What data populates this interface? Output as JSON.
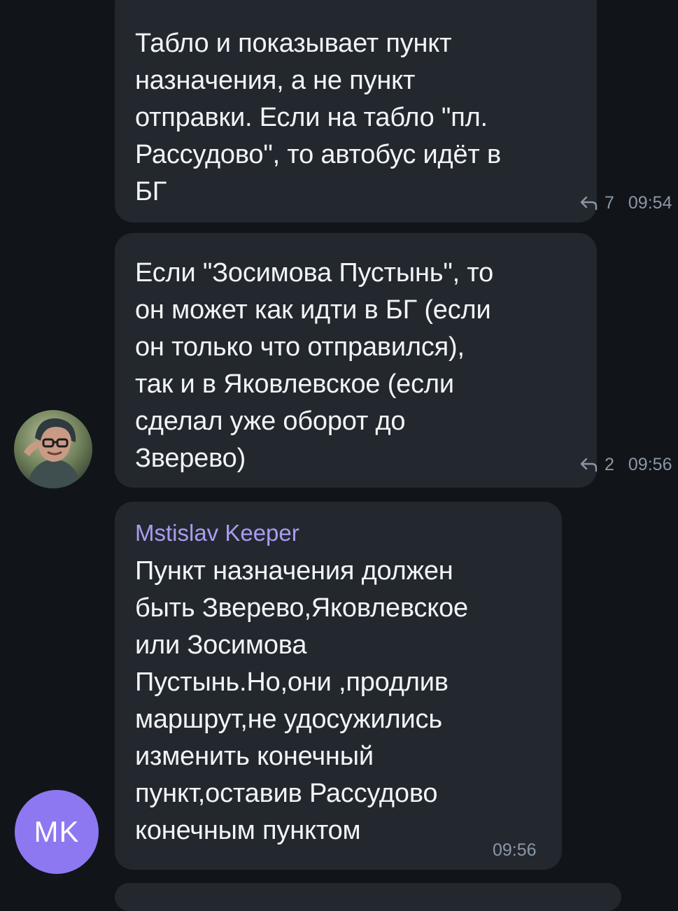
{
  "messages": [
    {
      "sender": "",
      "text": "Табло и показывает пункт\nназначения, а не пункт\nотправки. Если на табло \"пл.\nРассудово\", то автобус идёт в\nБГ",
      "reply_count": "7",
      "time": "09:54"
    },
    {
      "sender": "",
      "text": "Если \"Зосимова Пустынь\", то\nон может как идти в БГ (если\nон только что отправился),\nтак и в Яковлевское (если\nсделал уже оборот до\nЗверево)",
      "reply_count": "2",
      "time": "09:56"
    },
    {
      "sender": "Mstislav Keeper",
      "text": "Пункт назначения должен\nбыть Зверево,Яковлевское\nили Зосимова\nПустынь.Но,они ,продлив\nмаршрут,не удосужились\nизменить конечный\nпункт,оставив Рассудово\nконечным пунктом",
      "reply_count": "",
      "time": "09:56"
    }
  ],
  "avatars": {
    "mk_initials": "MK",
    "mk_color": "#8d78f2"
  },
  "colors": {
    "background": "#111419",
    "bubble": "#23282f",
    "sender_name": "#a99cf2",
    "meta": "#8b97a5"
  }
}
